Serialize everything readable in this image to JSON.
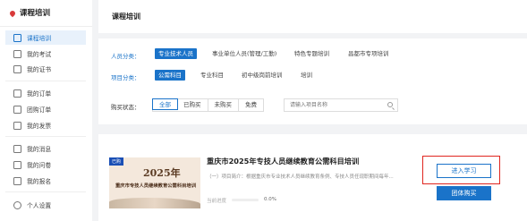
{
  "sidebar": {
    "title": "课程培训",
    "items": [
      {
        "label": "课程培训",
        "icon": "book-icon"
      },
      {
        "label": "我的考试",
        "icon": "exam-icon"
      },
      {
        "label": "我的证书",
        "icon": "certificate-icon"
      },
      {
        "label": "我的订单",
        "icon": "order-icon"
      },
      {
        "label": "团购订单",
        "icon": "group-order-icon"
      },
      {
        "label": "我的发票",
        "icon": "invoice-icon"
      },
      {
        "label": "我的消息",
        "icon": "message-icon"
      },
      {
        "label": "我的问卷",
        "icon": "survey-icon"
      },
      {
        "label": "我的报名",
        "icon": "signup-icon"
      },
      {
        "label": "个人设置",
        "icon": "settings-icon"
      }
    ]
  },
  "main": {
    "title": "课程培训"
  },
  "filters": {
    "personnel_label": "人员分类：",
    "personnel": [
      "专业技术人员",
      "事业单位人员(管理/工勤)",
      "特色专题培训",
      "昌都市专项培训"
    ],
    "project_label": "项目分类：",
    "project": [
      "公需科目",
      "专业科目",
      "初中级岗前培训",
      "培训"
    ],
    "buy_label": "购买状态：",
    "buy": [
      "全部",
      "已购买",
      "未购买",
      "免费"
    ],
    "search_placeholder": "请输入项目名称"
  },
  "course": {
    "cover_tag": "已购",
    "cover_year": "2025年",
    "cover_title": "重庆市专技人员继续教育公需科目培训",
    "cover_sub": "",
    "title": "重庆市2025年专技人员继续教育公需科目培训",
    "intro": "（一）项目简介：根据重庆市专业技术人员继续教育条例、专技人员任现职期间每年...",
    "progress_label": "当前进度",
    "progress_value": "0.0%",
    "progress_fraction": 0.0,
    "study_button": "进入学习",
    "group_button": "团体购买"
  },
  "colors": {
    "accent": "#1a73c9",
    "highlight": "#e0261f"
  }
}
